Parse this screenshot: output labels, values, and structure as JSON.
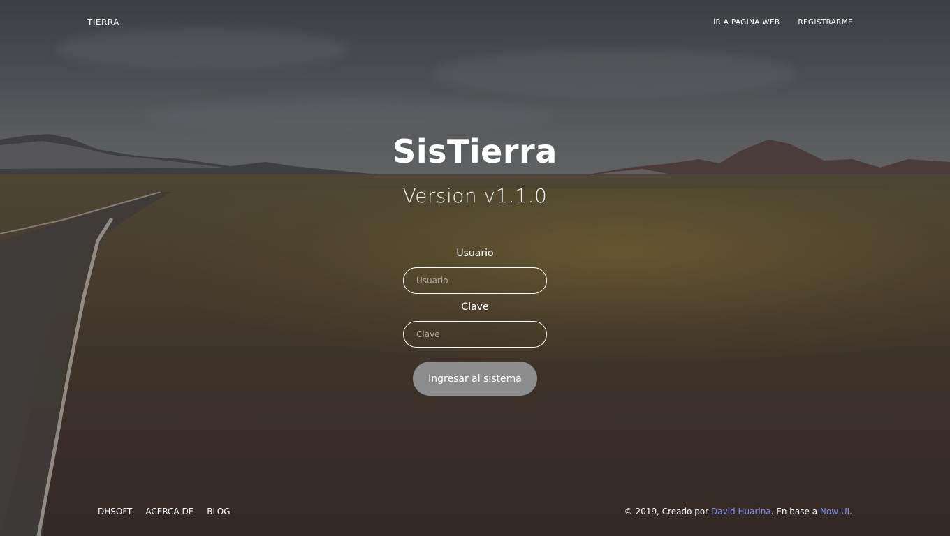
{
  "navbar": {
    "brand": "TIERRA",
    "links": [
      {
        "label": "IR A PAGINA WEB"
      },
      {
        "label": "REGISTRARME"
      }
    ]
  },
  "hero": {
    "title": "SisTierra",
    "subtitle": "Version v1.1.0"
  },
  "login_form": {
    "username_label": "Usuario",
    "username_placeholder": "Usuario",
    "username_value": "",
    "password_label": "Clave",
    "password_placeholder": "Clave",
    "password_value": "",
    "submit_label": "Ingresar al sistema"
  },
  "footer": {
    "links": [
      {
        "label": "DHSOFT"
      },
      {
        "label": "ACERCA DE"
      },
      {
        "label": "BLOG"
      }
    ],
    "copyright_prefix": "© 2019, Creado por ",
    "author": "David Huarina",
    "based_on_text": ". En base a ",
    "framework": "Now UI",
    "suffix": "."
  },
  "colors": {
    "button_bg": "#8d8d8d",
    "footer_link_accent": "#7b8ff5",
    "text": "#ffffff"
  }
}
